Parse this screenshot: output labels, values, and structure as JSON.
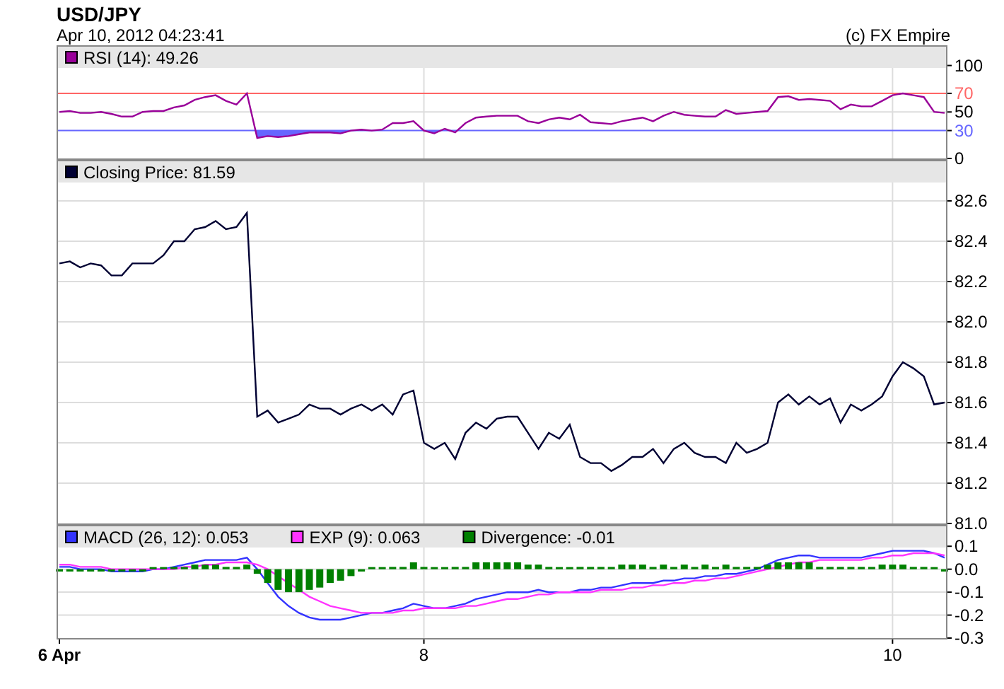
{
  "title": "USD/JPY",
  "timestamp": "Apr 10, 2012 04:23:41",
  "credit": "(c) FX Empire",
  "panels": [
    {
      "kind": "rsi",
      "chart_data": {
        "type": "line",
        "grid": true,
        "legend": true,
        "ylim": [
          0,
          121
        ],
        "yticks": [
          {
            "value": 0,
            "label": "0"
          },
          {
            "value": 30,
            "label": "30"
          },
          {
            "value": 50,
            "label": "50"
          },
          {
            "value": 70,
            "label": "70"
          },
          {
            "value": 100,
            "label": "100"
          }
        ],
        "ref_lines": [
          {
            "axis": "y",
            "value": 70,
            "color": "#ff6666"
          },
          {
            "axis": "y",
            "value": 30,
            "color": "#6666ff"
          }
        ],
        "series": [
          {
            "name": "RSI (14): 49.26",
            "color": "#990099",
            "values": [
              50,
              51,
              49,
              49,
              50,
              48,
              45,
              45,
              50,
              51,
              51,
              55,
              57,
              63,
              66,
              68,
              62,
              58,
              70,
              22,
              24,
              23,
              24,
              26,
              28,
              28,
              28,
              27,
              30,
              31,
              30,
              31,
              38,
              38,
              40,
              30,
              27,
              32,
              28,
              38,
              44,
              45,
              46,
              46,
              46,
              40,
              38,
              42,
              44,
              42,
              47,
              39,
              38,
              37,
              40,
              42,
              44,
              40,
              46,
              50,
              47,
              46,
              45,
              45,
              52,
              48,
              49,
              50,
              51,
              66,
              67,
              63,
              64,
              63,
              62,
              53,
              58,
              56,
              56,
              62,
              68,
              70,
              68,
              66,
              50,
              49
            ]
          }
        ]
      }
    },
    {
      "kind": "price",
      "chart_data": {
        "type": "line",
        "grid": true,
        "legend": true,
        "ylim": [
          81.0,
          82.8
        ],
        "yticks": [
          {
            "value": 81.0,
            "label": "81.0"
          },
          {
            "value": 81.2,
            "label": "81.2"
          },
          {
            "value": 81.4,
            "label": "81.4"
          },
          {
            "value": 81.6,
            "label": "81.6"
          },
          {
            "value": 81.8,
            "label": "81.8"
          },
          {
            "value": 82.0,
            "label": "82.0"
          },
          {
            "value": 82.2,
            "label": "82.2"
          },
          {
            "value": 82.4,
            "label": "82.4"
          },
          {
            "value": 82.6,
            "label": "82.6"
          }
        ],
        "series": [
          {
            "name": "Closing Price: 81.59",
            "color": "#000033",
            "values": [
              82.29,
              82.3,
              82.27,
              82.29,
              82.28,
              82.23,
              82.23,
              82.29,
              82.29,
              82.29,
              82.33,
              82.4,
              82.4,
              82.46,
              82.47,
              82.5,
              82.46,
              82.47,
              82.54,
              81.53,
              81.56,
              81.5,
              81.52,
              81.54,
              81.59,
              81.57,
              81.57,
              81.54,
              81.57,
              81.59,
              81.56,
              81.59,
              81.54,
              81.64,
              81.66,
              81.4,
              81.37,
              81.4,
              81.32,
              81.45,
              81.5,
              81.47,
              81.52,
              81.53,
              81.53,
              81.45,
              81.37,
              81.45,
              81.42,
              81.49,
              81.33,
              81.3,
              81.3,
              81.26,
              81.29,
              81.33,
              81.33,
              81.37,
              81.3,
              81.37,
              81.4,
              81.35,
              81.33,
              81.33,
              81.3,
              81.4,
              81.35,
              81.37,
              81.4,
              81.6,
              81.64,
              81.59,
              81.63,
              81.59,
              81.62,
              81.5,
              81.59,
              81.56,
              81.59,
              81.63,
              81.73,
              81.8,
              81.77,
              81.73,
              81.59,
              81.6
            ]
          }
        ]
      }
    },
    {
      "kind": "macd",
      "chart_data": {
        "type": "line",
        "grid": true,
        "legend": true,
        "ylim": [
          -0.3,
          0.19
        ],
        "yticks": [
          {
            "value": 0.1,
            "label": "0.1"
          },
          {
            "value": 0,
            "label": "0.0"
          },
          {
            "value": -0.1,
            "label": "-0.1"
          },
          {
            "value": -0.2,
            "label": "-0.2"
          },
          {
            "value": -0.3,
            "label": "-0.3"
          }
        ],
        "categories": [
          "6 Apr",
          null,
          null,
          null,
          null,
          null,
          null,
          null,
          null,
          null,
          null,
          null,
          null,
          null,
          null,
          null,
          null,
          null,
          null,
          null,
          null,
          null,
          null,
          null,
          null,
          null,
          null,
          null,
          null,
          null,
          null,
          null,
          null,
          null,
          null,
          "8",
          null,
          null,
          null,
          null,
          null,
          null,
          null,
          null,
          null,
          null,
          null,
          null,
          null,
          null,
          null,
          null,
          null,
          null,
          null,
          null,
          null,
          null,
          null,
          null,
          null,
          null,
          null,
          null,
          null,
          null,
          null,
          null,
          null,
          null,
          null,
          null,
          null,
          null,
          null,
          null,
          null,
          null,
          null,
          null,
          "10",
          null,
          null,
          null,
          null,
          null
        ],
        "series": [
          {
            "name": "MACD (26, 12): 0.053",
            "color": "#3333ff",
            "values": [
              0.01,
              0.01,
              0,
              0,
              0,
              -0.01,
              -0.01,
              -0.01,
              -0.01,
              0,
              0,
              0.01,
              0.02,
              0.03,
              0.04,
              0.04,
              0.04,
              0.04,
              0.05,
              0,
              -0.06,
              -0.12,
              -0.16,
              -0.19,
              -0.21,
              -0.22,
              -0.22,
              -0.22,
              -0.21,
              -0.2,
              -0.19,
              -0.19,
              -0.18,
              -0.17,
              -0.15,
              -0.16,
              -0.17,
              -0.17,
              -0.16,
              -0.15,
              -0.13,
              -0.12,
              -0.11,
              -0.1,
              -0.1,
              -0.1,
              -0.09,
              -0.1,
              -0.1,
              -0.1,
              -0.09,
              -0.09,
              -0.08,
              -0.08,
              -0.07,
              -0.06,
              -0.06,
              -0.06,
              -0.05,
              -0.05,
              -0.04,
              -0.04,
              -0.03,
              -0.03,
              -0.02,
              -0.02,
              -0.01,
              0,
              0.02,
              0.04,
              0.05,
              0.06,
              0.06,
              0.05,
              0.05,
              0.05,
              0.05,
              0.05,
              0.06,
              0.07,
              0.08,
              0.08,
              0.08,
              0.08,
              0.07,
              0.05
            ]
          },
          {
            "name": "EXP (9): 0.063",
            "color": "#ff33ff",
            "values": [
              0.02,
              0.02,
              0.01,
              0.01,
              0.01,
              0,
              0,
              0,
              0,
              0,
              0,
              0,
              0.01,
              0.01,
              0.02,
              0.02,
              0.03,
              0.03,
              0.03,
              0.02,
              0,
              -0.03,
              -0.06,
              -0.09,
              -0.12,
              -0.14,
              -0.16,
              -0.17,
              -0.18,
              -0.19,
              -0.19,
              -0.19,
              -0.19,
              -0.18,
              -0.18,
              -0.17,
              -0.17,
              -0.17,
              -0.17,
              -0.16,
              -0.16,
              -0.15,
              -0.14,
              -0.13,
              -0.13,
              -0.12,
              -0.11,
              -0.11,
              -0.1,
              -0.1,
              -0.1,
              -0.1,
              -0.09,
              -0.09,
              -0.09,
              -0.08,
              -0.08,
              -0.07,
              -0.07,
              -0.06,
              -0.06,
              -0.05,
              -0.05,
              -0.04,
              -0.04,
              -0.03,
              -0.02,
              -0.01,
              0,
              0.01,
              0.02,
              0.03,
              0.03,
              0.04,
              0.04,
              0.04,
              0.04,
              0.04,
              0.05,
              0.05,
              0.06,
              0.06,
              0.07,
              0.07,
              0.07,
              0.06
            ]
          },
          {
            "name": "Divergence: -0.01",
            "color": "#008000",
            "type": "bar",
            "values": [
              -0.01,
              -0.01,
              -0.01,
              -0.01,
              -0.01,
              -0.01,
              -0.01,
              -0.01,
              -0.01,
              0,
              0,
              0.01,
              0.01,
              0.02,
              0.02,
              0.02,
              0.01,
              0.01,
              0.02,
              -0.02,
              -0.06,
              -0.09,
              -0.1,
              -0.1,
              -0.09,
              -0.08,
              -0.06,
              -0.05,
              -0.03,
              -0.01,
              0,
              0,
              0.01,
              0.01,
              0.03,
              0.01,
              0,
              0,
              0.01,
              0.01,
              0.03,
              0.03,
              0.03,
              0.03,
              0.03,
              0.02,
              0.02,
              0.01,
              0,
              0,
              0.01,
              0.01,
              0.01,
              0.01,
              0.02,
              0.02,
              0.02,
              0.01,
              0.02,
              0.01,
              0.02,
              0.01,
              0.02,
              0.01,
              0.02,
              0.01,
              0.01,
              0.01,
              0.02,
              0.03,
              0.03,
              0.03,
              0.03,
              0.01,
              0.01,
              0.01,
              0.01,
              0.01,
              0.01,
              0.02,
              0.02,
              0.02,
              0.01,
              0.01,
              0,
              -0.01
            ]
          }
        ]
      }
    }
  ]
}
